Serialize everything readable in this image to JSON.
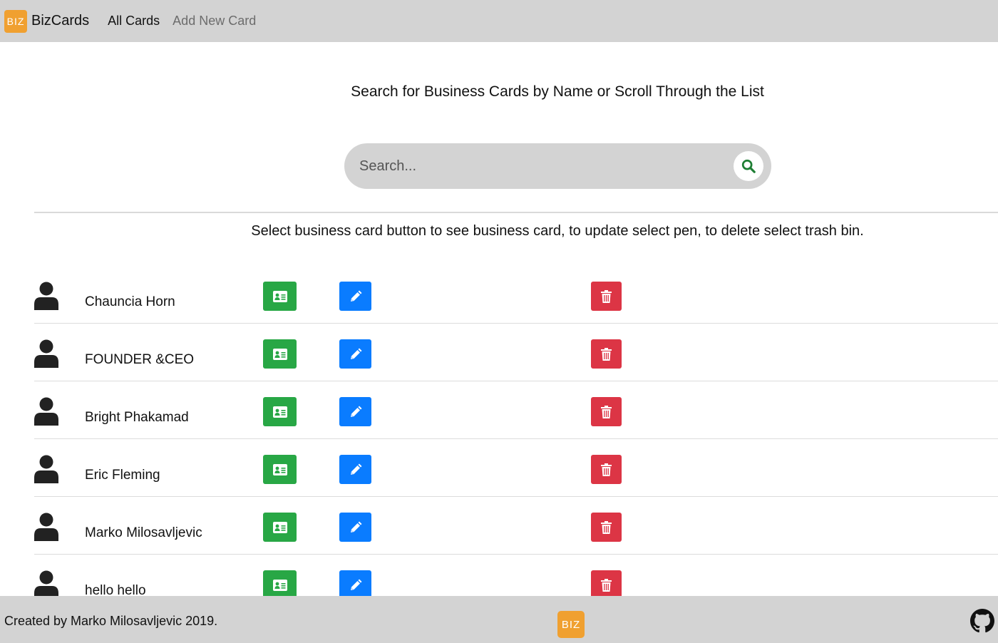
{
  "navbar": {
    "logo_text": "BIZ",
    "brand": "BizCards",
    "links": [
      "All Cards",
      "Add New Card"
    ]
  },
  "main": {
    "heading": "Search for Business Cards by Name or Scroll Through the List",
    "search": {
      "placeholder": "Search...",
      "value": "",
      "icon": "search-icon"
    },
    "instructions": "Select business card button to see business card, to update select pen, to delete select trash bin.",
    "cards": [
      {
        "name": "Chauncia Horn"
      },
      {
        "name": "FOUNDER &CEO"
      },
      {
        "name": "Bright Phakamad"
      },
      {
        "name": "Eric Fleming"
      },
      {
        "name": "Marko Milosavljevic"
      },
      {
        "name": "hello hello"
      }
    ],
    "actions": {
      "view": {
        "icon": "id-card-icon",
        "color": "#28a745"
      },
      "edit": {
        "icon": "pen-icon",
        "color": "#0a7cff"
      },
      "delete": {
        "icon": "trash-icon",
        "color": "#dc3545"
      }
    }
  },
  "footer": {
    "text": "Created by Marko Milosavljevic 2019.",
    "logo_text": "BIZ",
    "github_icon": "github-icon"
  },
  "colors": {
    "bar_bg": "#d3d3d3",
    "logo_orange": "#f0a030",
    "search_icon": "#1e7e34"
  }
}
